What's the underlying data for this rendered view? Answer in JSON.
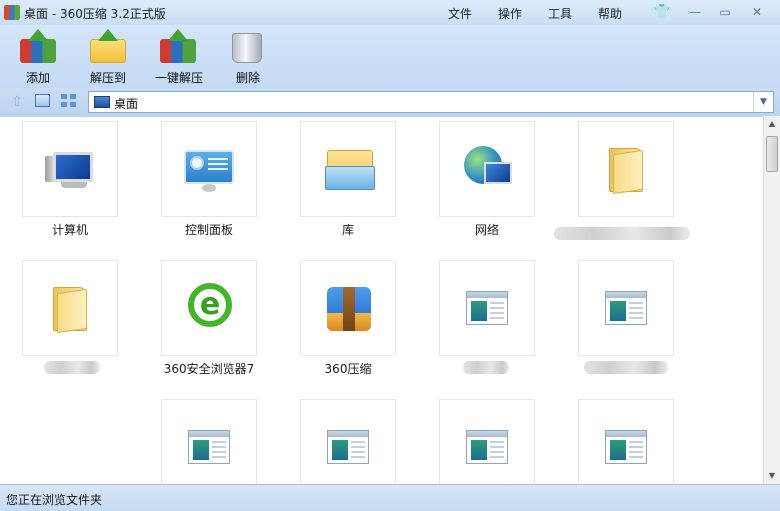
{
  "window": {
    "title": "桌面 - 360压缩 3.2正式版",
    "menu": [
      "文件",
      "操作",
      "工具",
      "帮助"
    ],
    "controls": {
      "minimize": "—",
      "restore": "▭",
      "close": "✕"
    }
  },
  "toolbar": {
    "buttons": [
      {
        "label": "添加",
        "icon": "add-archive-icon"
      },
      {
        "label": "解压到",
        "icon": "extract-to-icon"
      },
      {
        "label": "一键解压",
        "icon": "one-click-extract-icon"
      },
      {
        "label": "删除",
        "icon": "delete-trash-icon"
      }
    ]
  },
  "address": {
    "path": "桌面",
    "up_glyph": "⇧",
    "dropdown_glyph": "▼"
  },
  "scrollbar": {
    "up_glyph": "▲",
    "down_glyph": "▼"
  },
  "items": [
    {
      "name": "计算机",
      "icon": "computer-icon"
    },
    {
      "name": "控制面板",
      "icon": "control-panel-icon"
    },
    {
      "name": "库",
      "icon": "library-icon"
    },
    {
      "name": "网络",
      "icon": "network-icon"
    },
    {
      "name": "",
      "icon": "folder-icon"
    },
    {
      "name": "",
      "icon": "folder-icon"
    },
    {
      "name": "360安全浏览器7",
      "icon": "360-browser-icon"
    },
    {
      "name": "360压缩",
      "icon": "360-zip-icon"
    },
    {
      "name": "",
      "icon": "application-icon"
    },
    {
      "name": "",
      "icon": "application-icon"
    },
    {
      "name": "",
      "icon": "application-icon"
    },
    {
      "name": "",
      "icon": "application-icon"
    },
    {
      "name": "",
      "icon": "application-icon"
    },
    {
      "name": "",
      "icon": "application-icon"
    }
  ],
  "status": {
    "text": "您正在浏览文件夹"
  },
  "colors": {
    "chrome": "#c9def5",
    "address_border": "#8ba9cc",
    "tile_border": "#e6e6e6"
  }
}
